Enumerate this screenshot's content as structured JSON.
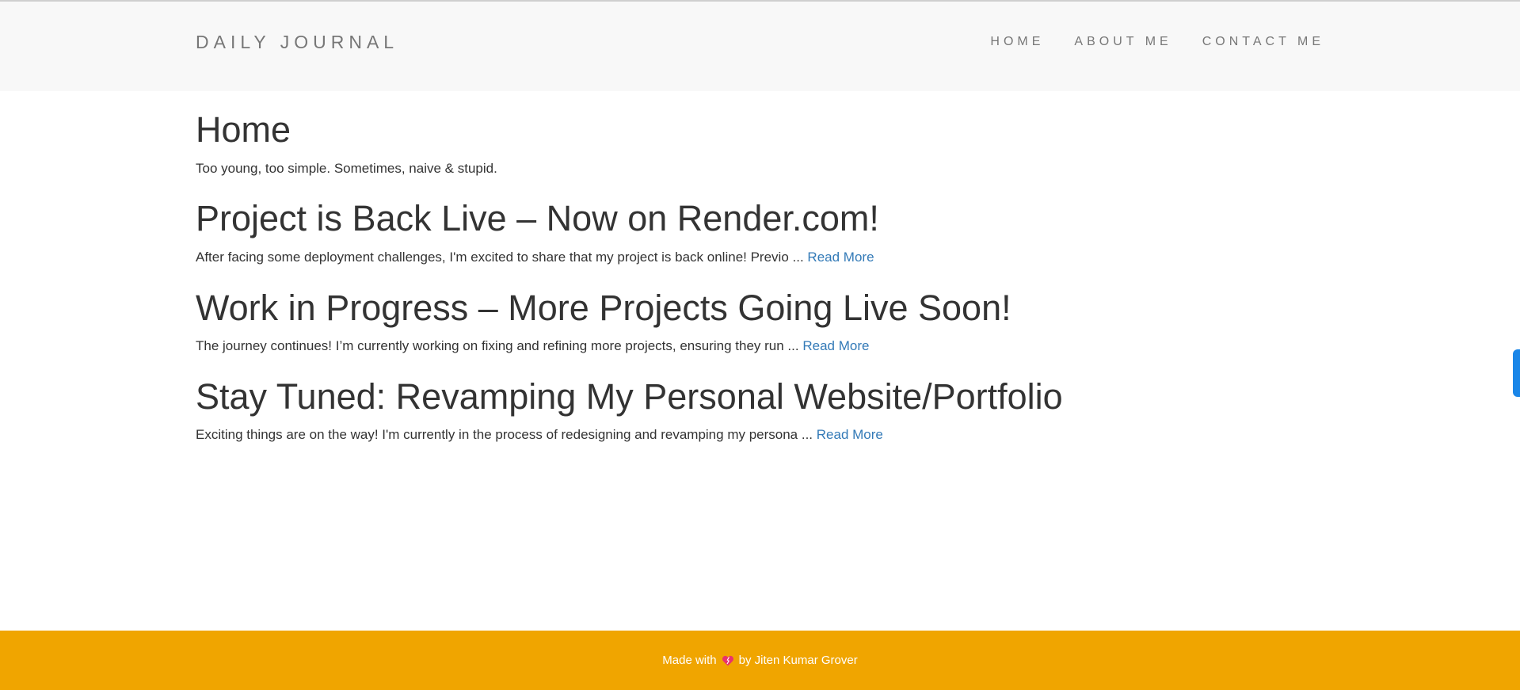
{
  "header": {
    "brand": "DAILY JOURNAL",
    "nav": [
      "HOME",
      "ABOUT ME",
      "CONTACT ME"
    ]
  },
  "main": {
    "title": "Home",
    "tagline": "Too young, too simple. Sometimes, naive & stupid.",
    "posts": [
      {
        "title": "Project is Back Live – Now on Render.com!",
        "excerpt": "After facing some deployment challenges, I'm excited to share that my project is back online! Previo ...",
        "link": "Read More"
      },
      {
        "title": "Work in Progress – More Projects Going Live Soon!",
        "excerpt": "The journey continues! I’m currently working on fixing and refining more projects, ensuring they run ...",
        "link": "Read More"
      },
      {
        "title": "Stay Tuned: Revamping My Personal Website/Portfolio",
        "excerpt": "Exciting things are on the way! I'm currently in the process of redesigning and revamping my persona ...",
        "link": "Read More"
      }
    ]
  },
  "footer": {
    "prefix": "Made with",
    "icon": "heart-icon",
    "suffix": "by Jiten Kumar Grover"
  },
  "colors": {
    "navbar_bg": "#f8f8f8",
    "link": "#337ab7",
    "footer_bg": "#f0a500",
    "side_tab": "#1a86e8"
  }
}
